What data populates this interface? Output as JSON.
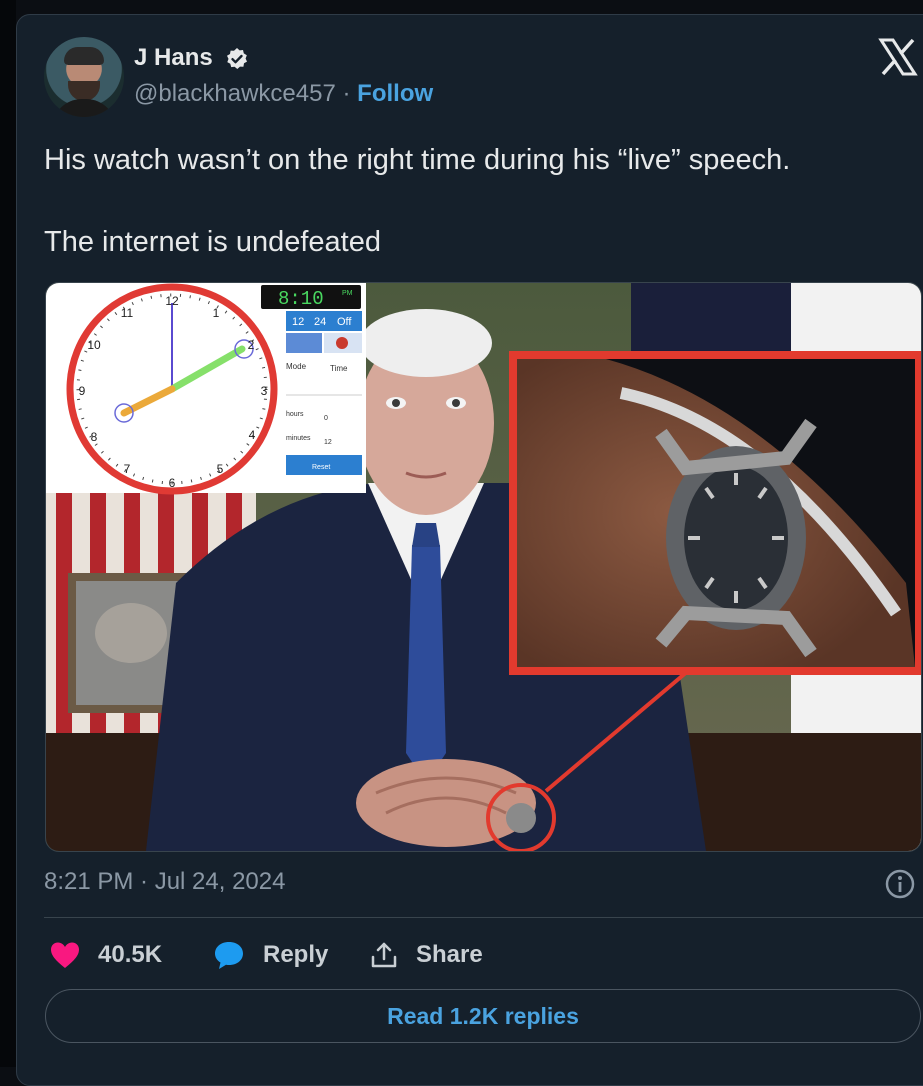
{
  "author": {
    "name": "J Hans",
    "handle": "@blackhawkce457",
    "separator": "·",
    "follow_label": "Follow"
  },
  "tweet": {
    "text": "His watch wasn’t on the right time during his “live” speech.\n\nThe internet is undefeated",
    "timestamp": "8:21 PM · Jul 24, 2024"
  },
  "media": {
    "clock_digital_time": "8:10",
    "clock_digital_suffix": "PM",
    "clock_buttons": [
      "12",
      "24",
      "Off"
    ],
    "clock_mode_label": "Mode",
    "clock_mode_value": "Time",
    "clock_hours_label": "hours",
    "clock_hours_value": "0",
    "clock_minutes_label": "minutes",
    "clock_minutes_value": "12",
    "clock_reset_label": "Reset",
    "clock_numbers": [
      "12",
      "1",
      "2",
      "3",
      "4",
      "5",
      "6",
      "7",
      "8",
      "9",
      "10",
      "11"
    ]
  },
  "actions": {
    "like_count": "40.5K",
    "reply_label": "Reply",
    "share_label": "Share",
    "read_replies_label": "Read 1.2K replies"
  },
  "colors": {
    "background": "#15202b",
    "accent": "#4aa3e0",
    "like": "#f91880",
    "reply": "#1d9bf0"
  }
}
